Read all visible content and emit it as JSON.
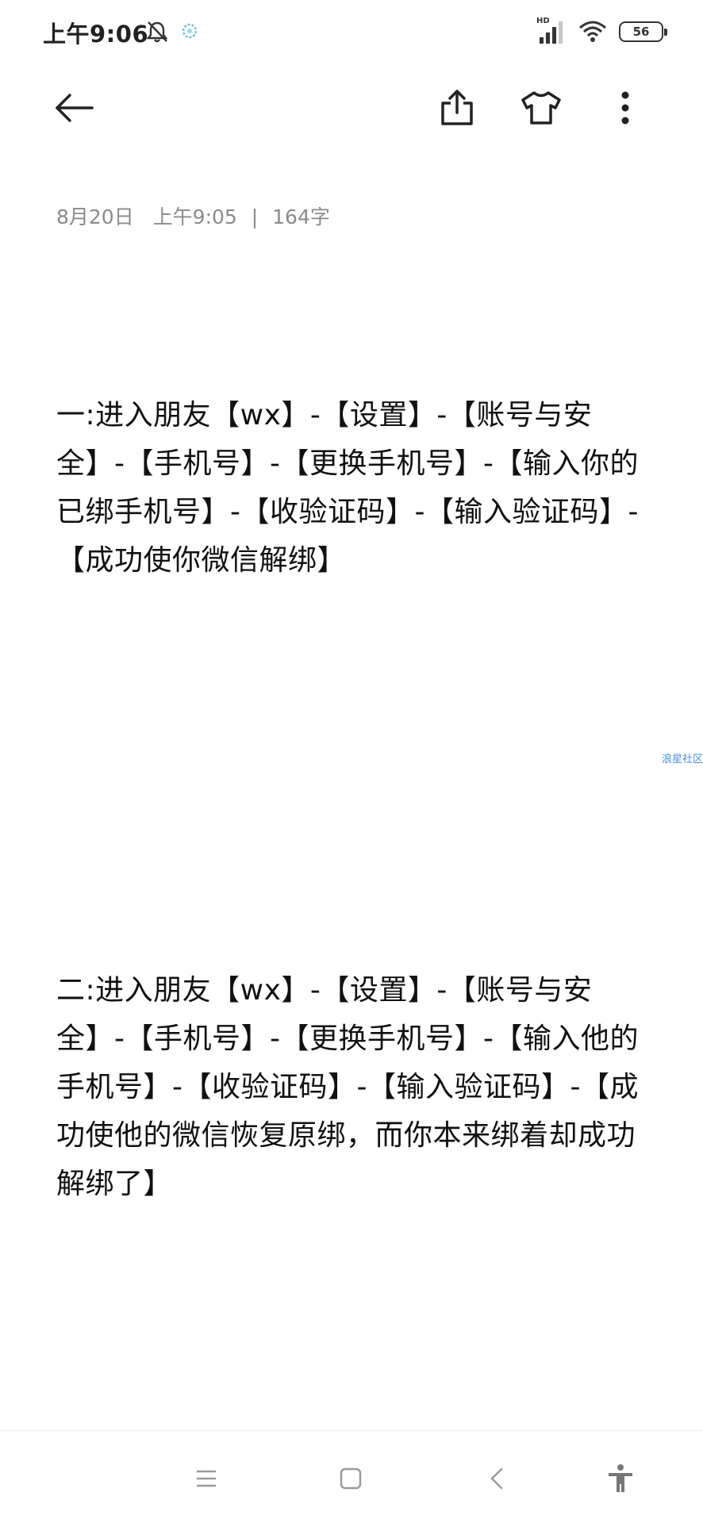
{
  "status_bar": {
    "time": "上午9:06",
    "network_type": "HD",
    "battery_level": "56"
  },
  "toolbar": {
    "back_icon": "arrow-left-icon",
    "share_icon": "share-icon",
    "theme_icon": "tshirt-icon",
    "more_icon": "more-vertical-icon"
  },
  "note": {
    "date": "8月20日",
    "time": "上午9:05",
    "separator": "|",
    "word_count": "164字",
    "paragraphs": [
      "一:进入朋友【wx】-【设置】-【账号与安全】-【手机号】-【更换手机号】-【输入你的已绑手机号】-【收验证码】-【输入验证码】-【成功使你微信解绑】",
      "二:进入朋友【wx】-【设置】-【账号与安全】-【手机号】-【更换手机号】-【输入他的手机号】-【收验证码】-【输入验证码】-【成功使他的微信恢复原绑，而你本来绑着却成功解绑了】"
    ]
  },
  "watermark": "浪星社区",
  "nav_bar": {
    "menu_icon": "menu-icon",
    "home_icon": "home-square-icon",
    "back_icon": "chevron-left-icon",
    "accessibility_icon": "accessibility-icon"
  },
  "colors": {
    "background": "#ffffff",
    "text": "#111111",
    "meta_text": "#8a8a8a",
    "watermark": "#4a90d9"
  }
}
